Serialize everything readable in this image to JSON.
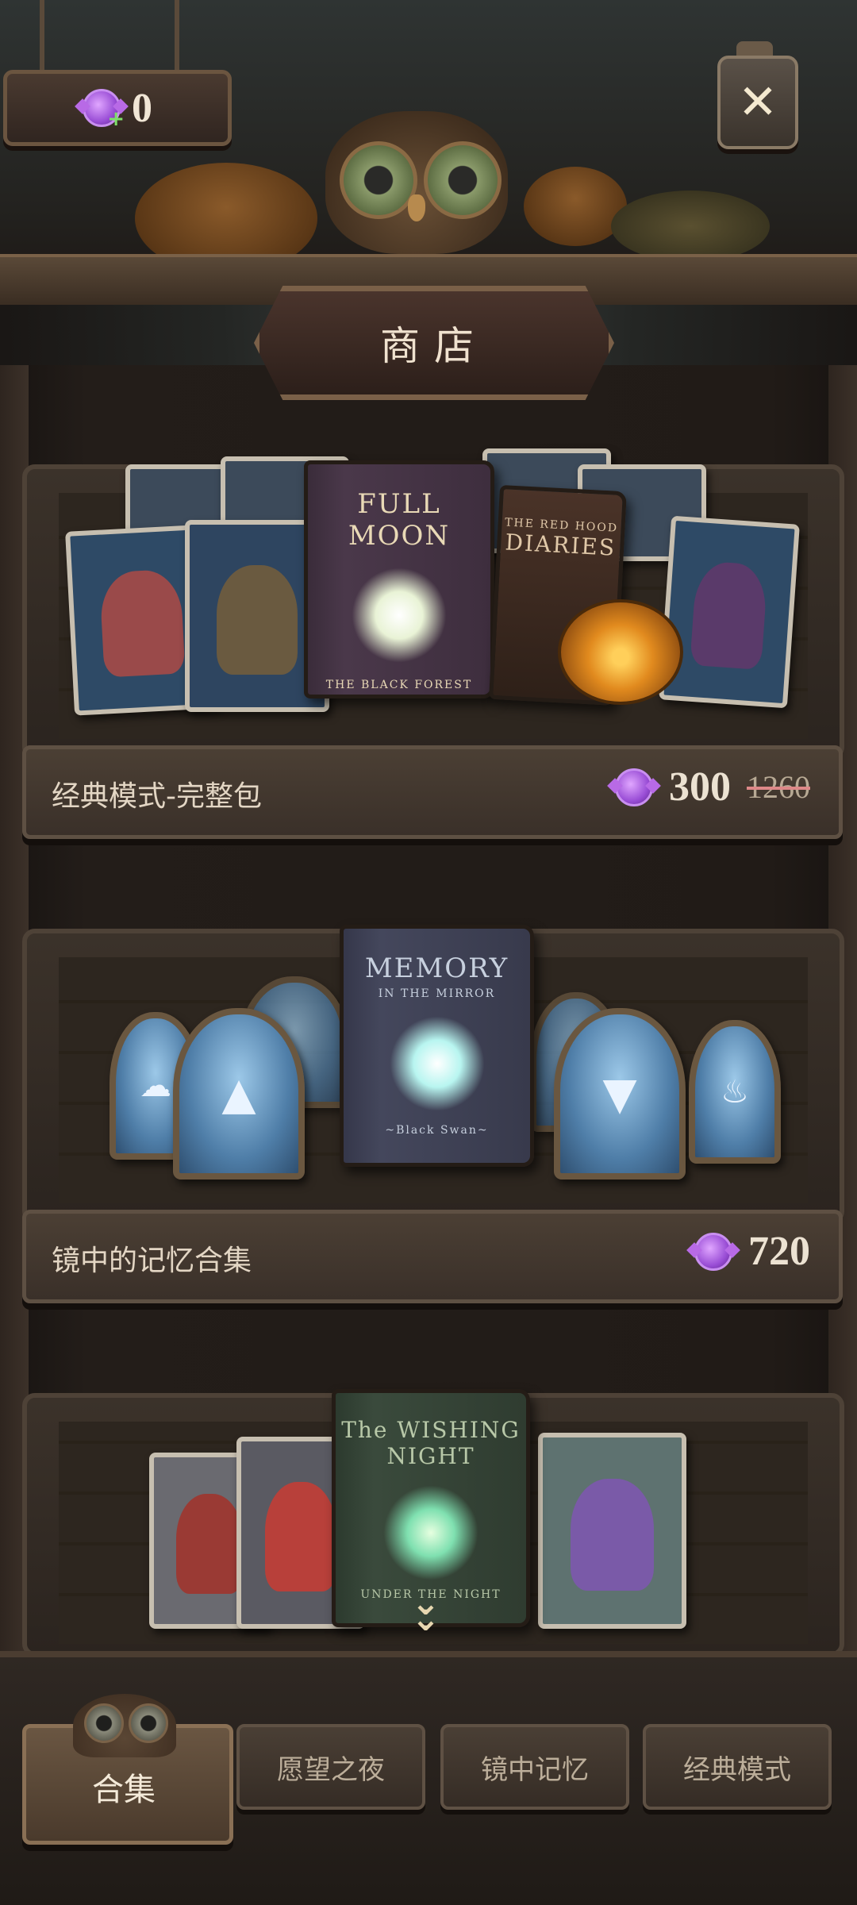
{
  "header": {
    "currency_value": "0",
    "close_label": "✕",
    "title": "商店"
  },
  "packs": [
    {
      "name": "经典模式-完整包",
      "price": "300",
      "old_price": "1260",
      "book_title": "FULL MOON",
      "book_sub": "THE BLACK FOREST",
      "side_book_title": "DIARIES",
      "side_book_sub": "THE RED HOOD"
    },
    {
      "name": "镜中的记忆合集",
      "price": "720",
      "book_title": "MEMORY",
      "book_sub": "IN THE MIRROR",
      "book_footer": "~Black Swan~"
    },
    {
      "book_title": "The WISHING NIGHT",
      "book_sub": "UNDER THE NIGHT"
    }
  ],
  "nav": {
    "tabs": [
      {
        "label": "合集",
        "active": true
      },
      {
        "label": "愿望之夜",
        "active": false
      },
      {
        "label": "镜中记忆",
        "active": false
      },
      {
        "label": "经典模式",
        "active": false
      }
    ]
  },
  "colors": {
    "accent_candy": "#9a4ed6",
    "text_light": "#ece2d2",
    "wood": "#4b3f34"
  }
}
